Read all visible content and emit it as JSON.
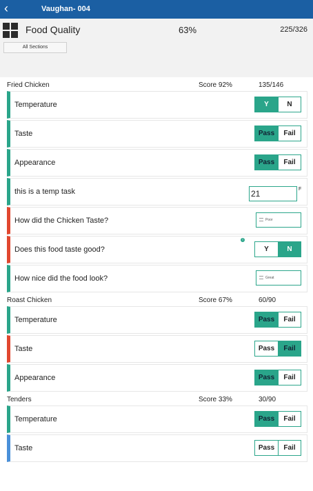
{
  "app": {
    "back_icon": "chevron-left-icon",
    "title": "Vaughan- 004"
  },
  "header": {
    "section_icon": "grid-icon",
    "title": "Food Quality",
    "percent": "63%",
    "fraction": "225/326",
    "all_sections_label": "All Sections"
  },
  "colors": {
    "accent": "#2aa58a",
    "topbar": "#1b5fa3",
    "fail_indicator": "#e1472f",
    "pending_indicator": "#4a90d9"
  },
  "sections": [
    {
      "name": "Fried Chicken",
      "score": "Score  92%",
      "fraction": "135/146",
      "items": [
        {
          "label": "Temperature",
          "type": "yn",
          "options": [
            "Y",
            "N"
          ],
          "selected": "Y",
          "status": "pass"
        },
        {
          "label": "Taste",
          "type": "passfail",
          "options": [
            "Pass",
            "Fail"
          ],
          "selected": "Pass",
          "status": "pass"
        },
        {
          "label": "Appearance",
          "type": "passfail",
          "options": [
            "Pass",
            "Fail"
          ],
          "selected": "Pass",
          "status": "pass"
        },
        {
          "label": "this is a temp task",
          "type": "temp",
          "value": "21",
          "unit": "F",
          "status": "pass"
        },
        {
          "label": "How did the Chicken Taste?",
          "type": "select",
          "value": "Poor",
          "status": "fail"
        },
        {
          "label": "Does this food taste good?",
          "type": "yn",
          "options": [
            "Y",
            "N"
          ],
          "selected": "N",
          "status": "fail",
          "info_icon": "info-icon"
        },
        {
          "label": "How nice did the food look?",
          "type": "select",
          "value": "Great",
          "status": "pass"
        }
      ]
    },
    {
      "name": "Roast Chicken",
      "score": "Score  67%",
      "fraction": "60/90",
      "items": [
        {
          "label": "Temperature",
          "type": "passfail",
          "options": [
            "Pass",
            "Fail"
          ],
          "selected": "Pass",
          "status": "pass"
        },
        {
          "label": "Taste",
          "type": "passfail",
          "options": [
            "Pass",
            "Fail"
          ],
          "selected": "Fail",
          "status": "fail"
        },
        {
          "label": "Appearance",
          "type": "passfail",
          "options": [
            "Pass",
            "Fail"
          ],
          "selected": "Pass",
          "status": "pass"
        }
      ]
    },
    {
      "name": "Tenders",
      "score": "Score  33%",
      "fraction": "30/90",
      "items": [
        {
          "label": "Temperature",
          "type": "passfail",
          "options": [
            "Pass",
            "Fail"
          ],
          "selected": "Pass",
          "status": "pass"
        },
        {
          "label": "Taste",
          "type": "passfail",
          "options": [
            "Pass",
            "Fail"
          ],
          "selected": "",
          "status": "pending"
        }
      ]
    }
  ]
}
